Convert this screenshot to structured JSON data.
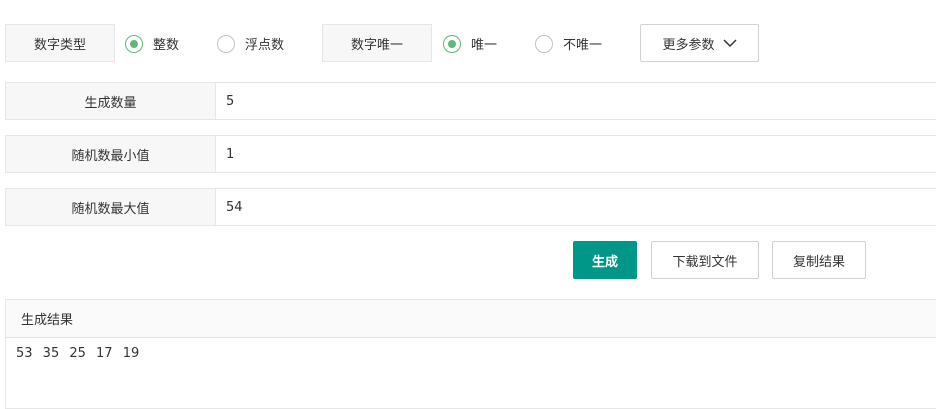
{
  "number_type": {
    "label": "数字类型",
    "options": [
      {
        "label": "整数",
        "checked": true
      },
      {
        "label": "浮点数",
        "checked": false
      }
    ]
  },
  "number_unique": {
    "label": "数字唯一",
    "options": [
      {
        "label": "唯一",
        "checked": true
      },
      {
        "label": "不唯一",
        "checked": false
      }
    ]
  },
  "more_params": {
    "label": "更多参数",
    "icon": "chevron-down-icon"
  },
  "fields": [
    {
      "label": "生成数量",
      "value": "5"
    },
    {
      "label": "随机数最小值",
      "value": "1"
    },
    {
      "label": "随机数最大值",
      "value": "54"
    }
  ],
  "actions": {
    "generate": "生成",
    "download": "下载到文件",
    "copy": "复制结果"
  },
  "result": {
    "title": "生成结果",
    "text": "53 35 25 17 19"
  },
  "colors": {
    "accent": "#009688",
    "radio_checked": "#5fb878"
  }
}
